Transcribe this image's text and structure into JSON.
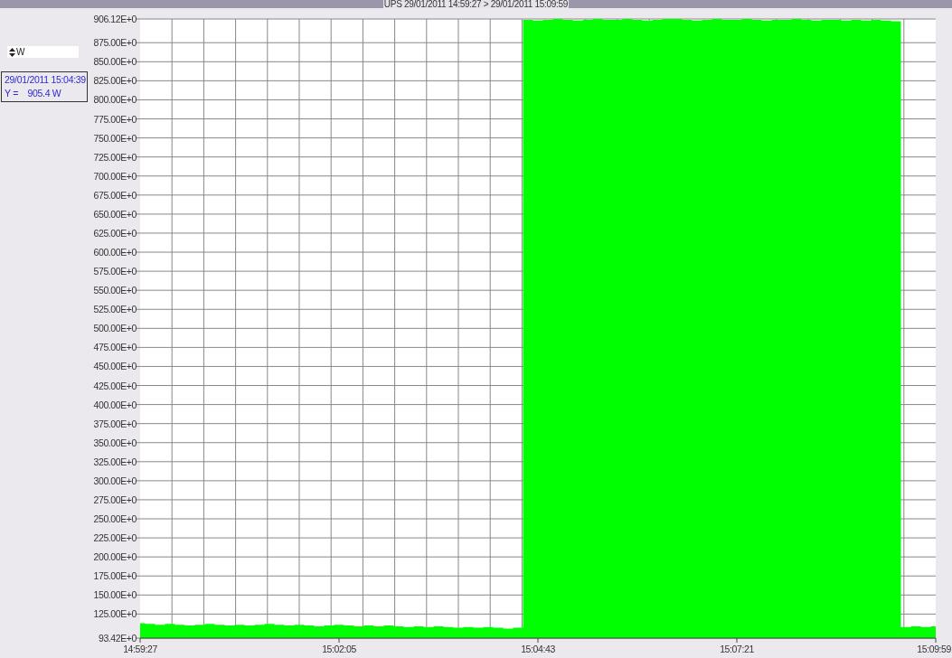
{
  "title_bar": {
    "title": "UPS  29/01/2011 14:59:27 > 29/01/2011 15:09:59"
  },
  "unit_selector": {
    "value": "W"
  },
  "cursor_readout": {
    "time": "29/01/2011 15:04:39",
    "value": "Y =    905.4 W"
  },
  "chart": {
    "chart_data": {
      "type": "area",
      "categories": [
        "14:59:27",
        null,
        null,
        null,
        null,
        null,
        null,
        null,
        null,
        null,
        null,
        null,
        null,
        null,
        null,
        null,
        null,
        null,
        null,
        null,
        "15:02:05",
        null,
        null,
        null,
        null,
        null,
        null,
        null,
        null,
        null,
        null,
        null,
        null,
        null,
        null,
        null,
        null,
        null,
        null,
        null,
        "15:04:43",
        null,
        null,
        null,
        null,
        null,
        null,
        null,
        null,
        null,
        null,
        null,
        null,
        null,
        null,
        null,
        null,
        null,
        null,
        null,
        "15:07:21",
        null,
        null,
        null,
        null,
        null,
        null,
        null,
        null,
        null,
        null,
        null,
        null,
        null,
        null,
        null,
        null,
        null,
        null,
        null,
        "15:09:59"
      ],
      "series": [
        {
          "color": "#00ff00",
          "values": [
            113,
            112,
            111,
            112,
            111,
            110,
            111,
            112,
            111,
            110,
            111,
            110,
            111,
            112,
            111,
            110,
            111,
            110,
            109,
            110,
            111,
            110,
            109,
            110,
            109,
            110,
            109,
            108,
            109,
            108,
            109,
            108,
            107,
            108,
            107,
            108,
            107,
            106,
            107,
            905,
            904,
            905,
            906,
            905,
            904,
            905,
            906,
            905,
            905,
            906,
            905,
            904,
            905,
            906,
            906,
            905,
            904,
            905,
            906,
            905,
            905,
            906,
            905,
            904,
            905,
            905,
            906,
            905,
            904,
            905,
            905,
            904,
            905,
            904,
            905,
            904,
            903,
            108,
            109,
            108,
            109
          ]
        }
      ],
      "ylim": [
        93.42,
        906.12
      ],
      "grid": true,
      "yticks": [
        {
          "value": 93.42,
          "label": "93.42E+0"
        },
        {
          "value": 125,
          "label": "125.00E+0"
        },
        {
          "value": 150,
          "label": "150.00E+0"
        },
        {
          "value": 175,
          "label": "175.00E+0"
        },
        {
          "value": 200,
          "label": "200.00E+0"
        },
        {
          "value": 225,
          "label": "225.00E+0"
        },
        {
          "value": 250,
          "label": "250.00E+0"
        },
        {
          "value": 275,
          "label": "275.00E+0"
        },
        {
          "value": 300,
          "label": "300.00E+0"
        },
        {
          "value": 325,
          "label": "325.00E+0"
        },
        {
          "value": 350,
          "label": "350.00E+0"
        },
        {
          "value": 375,
          "label": "375.00E+0"
        },
        {
          "value": 400,
          "label": "400.00E+0"
        },
        {
          "value": 425,
          "label": "425.00E+0"
        },
        {
          "value": 450,
          "label": "450.00E+0"
        },
        {
          "value": 475,
          "label": "475.00E+0"
        },
        {
          "value": 500,
          "label": "500.00E+0"
        },
        {
          "value": 525,
          "label": "525.00E+0"
        },
        {
          "value": 550,
          "label": "550.00E+0"
        },
        {
          "value": 575,
          "label": "575.00E+0"
        },
        {
          "value": 600,
          "label": "600.00E+0"
        },
        {
          "value": 625,
          "label": "625.00E+0"
        },
        {
          "value": 650,
          "label": "650.00E+0"
        },
        {
          "value": 675,
          "label": "675.00E+0"
        },
        {
          "value": 700,
          "label": "700.00E+0"
        },
        {
          "value": 725,
          "label": "725.00E+0"
        },
        {
          "value": 750,
          "label": "750.00E+0"
        },
        {
          "value": 775,
          "label": "775.00E+0"
        },
        {
          "value": 800,
          "label": "800.00E+0"
        },
        {
          "value": 825,
          "label": "825.00E+0"
        },
        {
          "value": 850,
          "label": "850.00E+0"
        },
        {
          "value": 875,
          "label": "875.00E+0"
        },
        {
          "value": 906.12,
          "label": "906.12E+0"
        }
      ]
    }
  }
}
